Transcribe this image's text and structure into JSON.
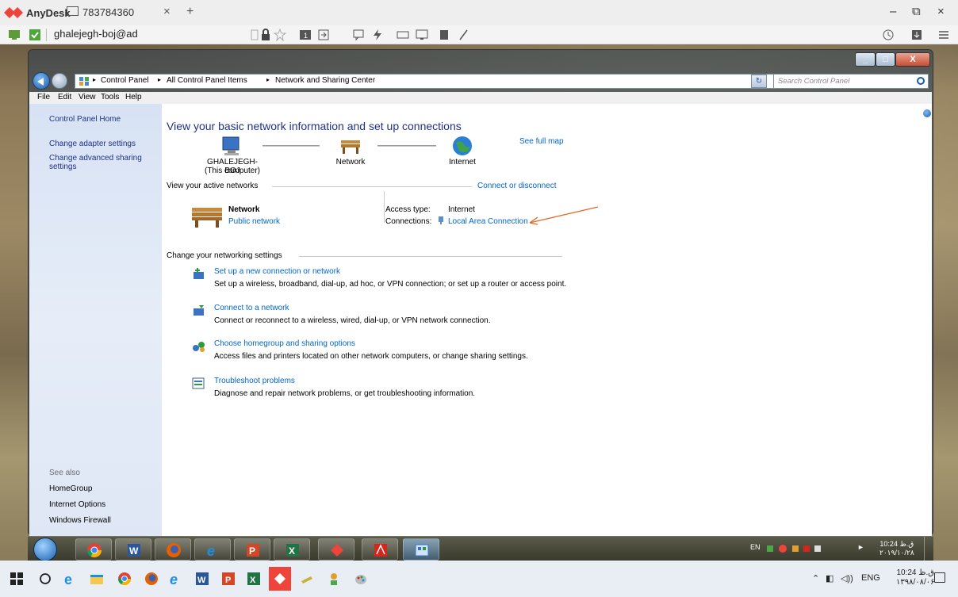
{
  "anydesk": {
    "app_name": "AnyDesk",
    "tab_label": "783784360",
    "close_glyph": "×",
    "new_tab_glyph": "+",
    "address": "ghalejegh-boj@ad",
    "window_controls": {
      "minimize": "–",
      "maximize": "⧉",
      "close": "×"
    },
    "accent_color": "#ef443b"
  },
  "win7_window": {
    "breadcrumbs": [
      "Control Panel",
      "All Control Panel Items",
      "Network and Sharing Center"
    ],
    "breadcrumb_sep": "▸",
    "search_placeholder": "Search Control Panel",
    "menu": [
      "File",
      "Edit",
      "View",
      "Tools",
      "Help"
    ],
    "sidebar": {
      "links": [
        "Control Panel Home",
        "Change adapter settings",
        "Change advanced sharing settings"
      ],
      "see_also_label": "See also",
      "see_also": [
        "HomeGroup",
        "Internet Options",
        "Windows Firewall"
      ]
    },
    "main": {
      "title": "View your basic network information and set up connections",
      "see_full_map": "See full map",
      "map_nodes": [
        {
          "label": "GHALEJEGH-BOJ",
          "sub": "(This computer)"
        },
        {
          "label": "Network",
          "sub": ""
        },
        {
          "label": "Internet",
          "sub": ""
        }
      ],
      "active_networks_header": "View your active networks",
      "connect_or_disconnect": "Connect or disconnect",
      "active_network": {
        "name": "Network",
        "type": "Public network",
        "access_type_label": "Access type:",
        "access_type_value": "Internet",
        "connections_label": "Connections:",
        "connections_value": "Local Area Connection"
      },
      "change_settings_header": "Change your networking settings",
      "tasks": [
        {
          "title": "Set up a new connection or network",
          "desc": "Set up a wireless, broadband, dial-up, ad hoc, or VPN connection; or set up a router or access point."
        },
        {
          "title": "Connect to a network",
          "desc": "Connect or reconnect to a wireless, wired, dial-up, or VPN network connection."
        },
        {
          "title": "Choose homegroup and sharing options",
          "desc": "Access files and printers located on other network computers, or change sharing settings."
        },
        {
          "title": "Troubleshoot problems",
          "desc": "Diagnose and repair network problems, or get troubleshooting information."
        }
      ]
    }
  },
  "win7_taskbar": {
    "lang": "EN",
    "time": "10:24 ق.ظ",
    "date": "۲۰۱۹/۱۰/۲۸"
  },
  "win10_taskbar": {
    "lang": "ENG",
    "time": "10:24 ق.ظ",
    "date": "۱۳۹۸/۰۸/۰۶"
  }
}
